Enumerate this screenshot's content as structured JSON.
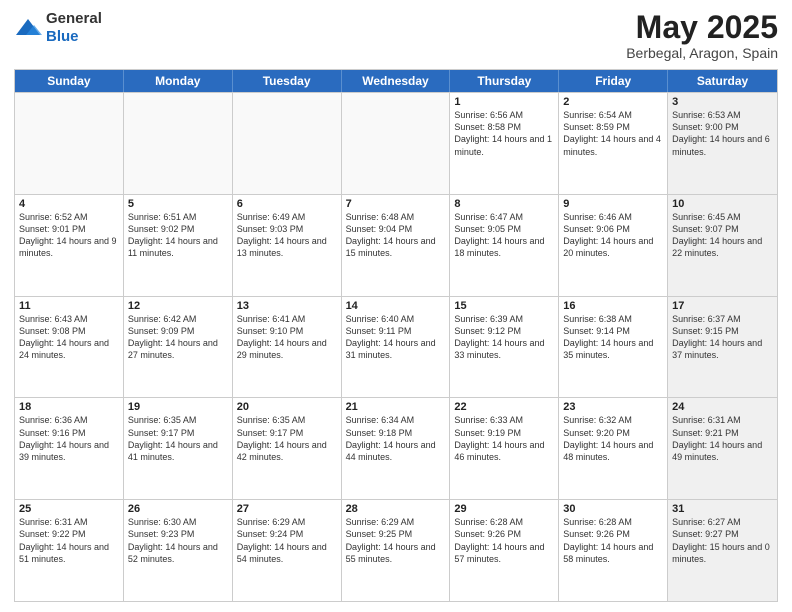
{
  "logo": {
    "general": "General",
    "blue": "Blue"
  },
  "title": {
    "month_year": "May 2025",
    "location": "Berbegal, Aragon, Spain"
  },
  "days_of_week": [
    "Sunday",
    "Monday",
    "Tuesday",
    "Wednesday",
    "Thursday",
    "Friday",
    "Saturday"
  ],
  "rows": [
    [
      {
        "day": "",
        "text": "",
        "empty": true
      },
      {
        "day": "",
        "text": "",
        "empty": true
      },
      {
        "day": "",
        "text": "",
        "empty": true
      },
      {
        "day": "",
        "text": "",
        "empty": true
      },
      {
        "day": "1",
        "text": "Sunrise: 6:56 AM\nSunset: 8:58 PM\nDaylight: 14 hours and 1 minute.",
        "empty": false
      },
      {
        "day": "2",
        "text": "Sunrise: 6:54 AM\nSunset: 8:59 PM\nDaylight: 14 hours and 4 minutes.",
        "empty": false
      },
      {
        "day": "3",
        "text": "Sunrise: 6:53 AM\nSunset: 9:00 PM\nDaylight: 14 hours and 6 minutes.",
        "empty": false,
        "shaded": true
      }
    ],
    [
      {
        "day": "4",
        "text": "Sunrise: 6:52 AM\nSunset: 9:01 PM\nDaylight: 14 hours and 9 minutes.",
        "empty": false
      },
      {
        "day": "5",
        "text": "Sunrise: 6:51 AM\nSunset: 9:02 PM\nDaylight: 14 hours and 11 minutes.",
        "empty": false
      },
      {
        "day": "6",
        "text": "Sunrise: 6:49 AM\nSunset: 9:03 PM\nDaylight: 14 hours and 13 minutes.",
        "empty": false
      },
      {
        "day": "7",
        "text": "Sunrise: 6:48 AM\nSunset: 9:04 PM\nDaylight: 14 hours and 15 minutes.",
        "empty": false
      },
      {
        "day": "8",
        "text": "Sunrise: 6:47 AM\nSunset: 9:05 PM\nDaylight: 14 hours and 18 minutes.",
        "empty": false
      },
      {
        "day": "9",
        "text": "Sunrise: 6:46 AM\nSunset: 9:06 PM\nDaylight: 14 hours and 20 minutes.",
        "empty": false
      },
      {
        "day": "10",
        "text": "Sunrise: 6:45 AM\nSunset: 9:07 PM\nDaylight: 14 hours and 22 minutes.",
        "empty": false,
        "shaded": true
      }
    ],
    [
      {
        "day": "11",
        "text": "Sunrise: 6:43 AM\nSunset: 9:08 PM\nDaylight: 14 hours and 24 minutes.",
        "empty": false
      },
      {
        "day": "12",
        "text": "Sunrise: 6:42 AM\nSunset: 9:09 PM\nDaylight: 14 hours and 27 minutes.",
        "empty": false
      },
      {
        "day": "13",
        "text": "Sunrise: 6:41 AM\nSunset: 9:10 PM\nDaylight: 14 hours and 29 minutes.",
        "empty": false
      },
      {
        "day": "14",
        "text": "Sunrise: 6:40 AM\nSunset: 9:11 PM\nDaylight: 14 hours and 31 minutes.",
        "empty": false
      },
      {
        "day": "15",
        "text": "Sunrise: 6:39 AM\nSunset: 9:12 PM\nDaylight: 14 hours and 33 minutes.",
        "empty": false
      },
      {
        "day": "16",
        "text": "Sunrise: 6:38 AM\nSunset: 9:14 PM\nDaylight: 14 hours and 35 minutes.",
        "empty": false
      },
      {
        "day": "17",
        "text": "Sunrise: 6:37 AM\nSunset: 9:15 PM\nDaylight: 14 hours and 37 minutes.",
        "empty": false,
        "shaded": true
      }
    ],
    [
      {
        "day": "18",
        "text": "Sunrise: 6:36 AM\nSunset: 9:16 PM\nDaylight: 14 hours and 39 minutes.",
        "empty": false
      },
      {
        "day": "19",
        "text": "Sunrise: 6:35 AM\nSunset: 9:17 PM\nDaylight: 14 hours and 41 minutes.",
        "empty": false
      },
      {
        "day": "20",
        "text": "Sunrise: 6:35 AM\nSunset: 9:17 PM\nDaylight: 14 hours and 42 minutes.",
        "empty": false
      },
      {
        "day": "21",
        "text": "Sunrise: 6:34 AM\nSunset: 9:18 PM\nDaylight: 14 hours and 44 minutes.",
        "empty": false
      },
      {
        "day": "22",
        "text": "Sunrise: 6:33 AM\nSunset: 9:19 PM\nDaylight: 14 hours and 46 minutes.",
        "empty": false
      },
      {
        "day": "23",
        "text": "Sunrise: 6:32 AM\nSunset: 9:20 PM\nDaylight: 14 hours and 48 minutes.",
        "empty": false
      },
      {
        "day": "24",
        "text": "Sunrise: 6:31 AM\nSunset: 9:21 PM\nDaylight: 14 hours and 49 minutes.",
        "empty": false,
        "shaded": true
      }
    ],
    [
      {
        "day": "25",
        "text": "Sunrise: 6:31 AM\nSunset: 9:22 PM\nDaylight: 14 hours and 51 minutes.",
        "empty": false
      },
      {
        "day": "26",
        "text": "Sunrise: 6:30 AM\nSunset: 9:23 PM\nDaylight: 14 hours and 52 minutes.",
        "empty": false
      },
      {
        "day": "27",
        "text": "Sunrise: 6:29 AM\nSunset: 9:24 PM\nDaylight: 14 hours and 54 minutes.",
        "empty": false
      },
      {
        "day": "28",
        "text": "Sunrise: 6:29 AM\nSunset: 9:25 PM\nDaylight: 14 hours and 55 minutes.",
        "empty": false
      },
      {
        "day": "29",
        "text": "Sunrise: 6:28 AM\nSunset: 9:26 PM\nDaylight: 14 hours and 57 minutes.",
        "empty": false
      },
      {
        "day": "30",
        "text": "Sunrise: 6:28 AM\nSunset: 9:26 PM\nDaylight: 14 hours and 58 minutes.",
        "empty": false
      },
      {
        "day": "31",
        "text": "Sunrise: 6:27 AM\nSunset: 9:27 PM\nDaylight: 15 hours and 0 minutes.",
        "empty": false,
        "shaded": true
      }
    ]
  ]
}
